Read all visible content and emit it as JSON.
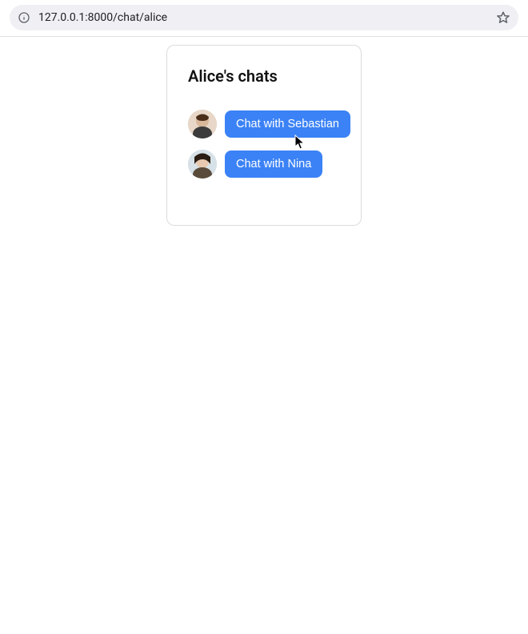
{
  "browser": {
    "url": "127.0.0.1:8000/chat/alice"
  },
  "card": {
    "title": "Alice's chats",
    "chats": [
      {
        "avatar_name": "sebastian-avatar",
        "button_label": "Chat with Sebastian"
      },
      {
        "avatar_name": "nina-avatar",
        "button_label": "Chat with Nina"
      }
    ]
  },
  "colors": {
    "button_bg": "#3b82f6",
    "button_text": "#ffffff",
    "card_border": "#dcdcdc"
  }
}
